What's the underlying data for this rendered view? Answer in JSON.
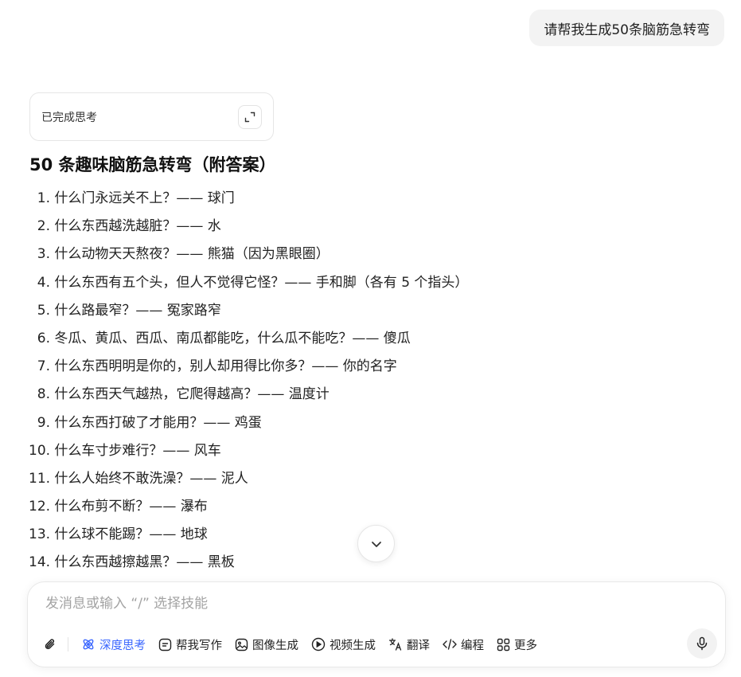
{
  "user_message": "请帮我生成50条脑筋急转弯",
  "thinking": {
    "label": "已完成思考"
  },
  "answer": {
    "title": "50 条趣味脑筋急转弯（附答案）",
    "items": [
      {
        "num": "1.",
        "text": "什么门永远关不上？—— 球门"
      },
      {
        "num": "2.",
        "text": "什么东西越洗越脏？—— 水"
      },
      {
        "num": "3.",
        "text": "什么动物天天熬夜？—— 熊猫（因为黑眼圈）"
      },
      {
        "num": "4.",
        "text": "什么东西有五个头，但人不觉得它怪？—— 手和脚（各有 5 个指头）"
      },
      {
        "num": "5.",
        "text": "什么路最窄？—— 冤家路窄"
      },
      {
        "num": "6.",
        "text": "冬瓜、黄瓜、西瓜、南瓜都能吃，什么瓜不能吃？—— 傻瓜"
      },
      {
        "num": "7.",
        "text": "什么东西明明是你的，别人却用得比你多？—— 你的名字"
      },
      {
        "num": "8.",
        "text": "什么东西天气越热，它爬得越高？—— 温度计"
      },
      {
        "num": "9.",
        "text": "什么东西打破了才能用？—— 鸡蛋"
      },
      {
        "num": "10.",
        "text": "什么车寸步难行？—— 风车"
      },
      {
        "num": "11.",
        "text": "什么人始终不敢洗澡？—— 泥人"
      },
      {
        "num": "12.",
        "text": "什么布剪不断？—— 瀑布"
      },
      {
        "num": "13.",
        "text": "什么球不能踢？—— 地球"
      },
      {
        "num": "14.",
        "text": "什么东西越擦越黑？—— 黑板"
      }
    ]
  },
  "composer": {
    "placeholder": "发消息或输入 “/” 选择技能",
    "tools": {
      "deep_think": "深度思考",
      "help_write": "帮我写作",
      "image_gen": "图像生成",
      "video_gen": "视频生成",
      "translate": "翻译",
      "coding": "编程",
      "more": "更多"
    }
  },
  "colors": {
    "accent": "#3a66ff",
    "bubble_bg": "#f3f3f3"
  }
}
